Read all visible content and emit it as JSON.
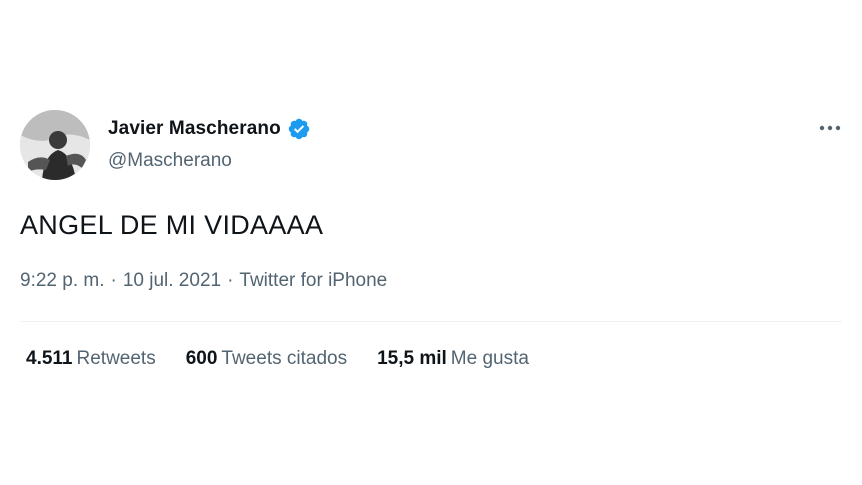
{
  "user": {
    "display_name": "Javier Mascherano",
    "handle": "@Mascherano",
    "verified": true,
    "avatar_icon": "user-avatar"
  },
  "tweet": {
    "text": "ANGEL DE MI VIDAAAA",
    "time": "9:22 p. m.",
    "separator": "·",
    "date": "10 jul. 2021",
    "source": "Twitter for iPhone"
  },
  "stats": [
    {
      "count": "4.511",
      "label": "Retweets"
    },
    {
      "count": "600",
      "label": "Tweets citados"
    },
    {
      "count": "15,5 mil",
      "label": "Me gusta"
    }
  ],
  "icons": {
    "verified": "verified-badge-icon",
    "more": "more-options-icon"
  },
  "colors": {
    "text_primary": "#0f1419",
    "text_secondary": "#536471",
    "verified_blue": "#1d9bf0",
    "divider": "#eff3f4"
  }
}
